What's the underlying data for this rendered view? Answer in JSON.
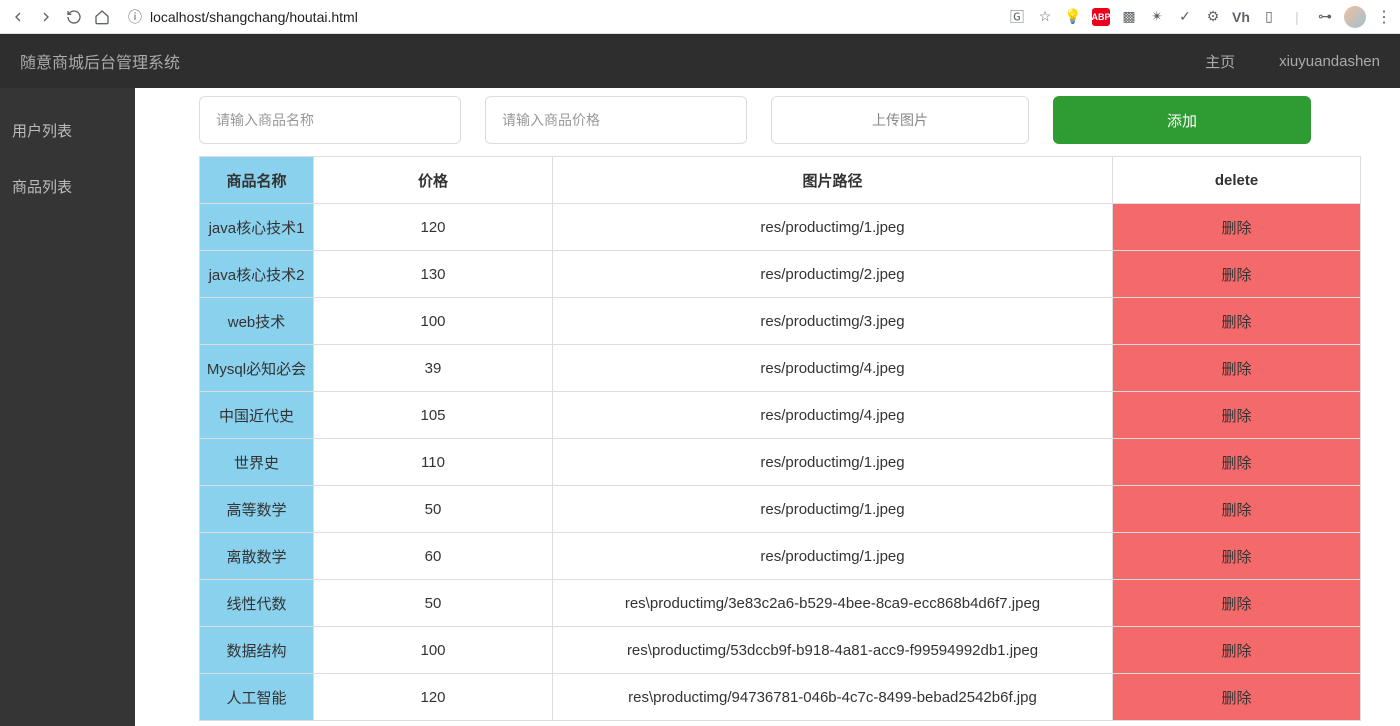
{
  "browser": {
    "url": "localhost/shangchang/houtai.html"
  },
  "header": {
    "title": "随意商城后台管理系统",
    "home": "主页",
    "user": "xiuyuandashen"
  },
  "sidebar": {
    "items": [
      {
        "label": "用户列表"
      },
      {
        "label": "商品列表"
      }
    ]
  },
  "controls": {
    "name_placeholder": "请输入商品名称",
    "price_placeholder": "请输入商品价格",
    "upload_label": "上传图片",
    "add_label": "添加"
  },
  "table": {
    "headers": {
      "name": "商品名称",
      "price": "价格",
      "path": "图片路径",
      "delete": "delete"
    },
    "delete_label": "删除",
    "rows": [
      {
        "name": "java核心技术1",
        "price": "120",
        "path": "res/productimg/1.jpeg"
      },
      {
        "name": "java核心技术2",
        "price": "130",
        "path": "res/productimg/2.jpeg"
      },
      {
        "name": "web技术",
        "price": "100",
        "path": "res/productimg/3.jpeg"
      },
      {
        "name": "Mysql必知必会",
        "price": "39",
        "path": "res/productimg/4.jpeg"
      },
      {
        "name": "中国近代史",
        "price": "105",
        "path": "res/productimg/4.jpeg"
      },
      {
        "name": "世界史",
        "price": "110",
        "path": "res/productimg/1.jpeg"
      },
      {
        "name": "高等数学",
        "price": "50",
        "path": "res/productimg/1.jpeg"
      },
      {
        "name": "离散数学",
        "price": "60",
        "path": "res/productimg/1.jpeg"
      },
      {
        "name": "线性代数",
        "price": "50",
        "path": "res\\productimg/3e83c2a6-b529-4bee-8ca9-ecc868b4d6f7.jpeg"
      },
      {
        "name": "数据结构",
        "price": "100",
        "path": "res\\productimg/53dccb9f-b918-4a81-acc9-f99594992db1.jpeg"
      },
      {
        "name": "人工智能",
        "price": "120",
        "path": "res\\productimg/94736781-046b-4c7c-8499-bebad2542b6f.jpg"
      }
    ]
  }
}
